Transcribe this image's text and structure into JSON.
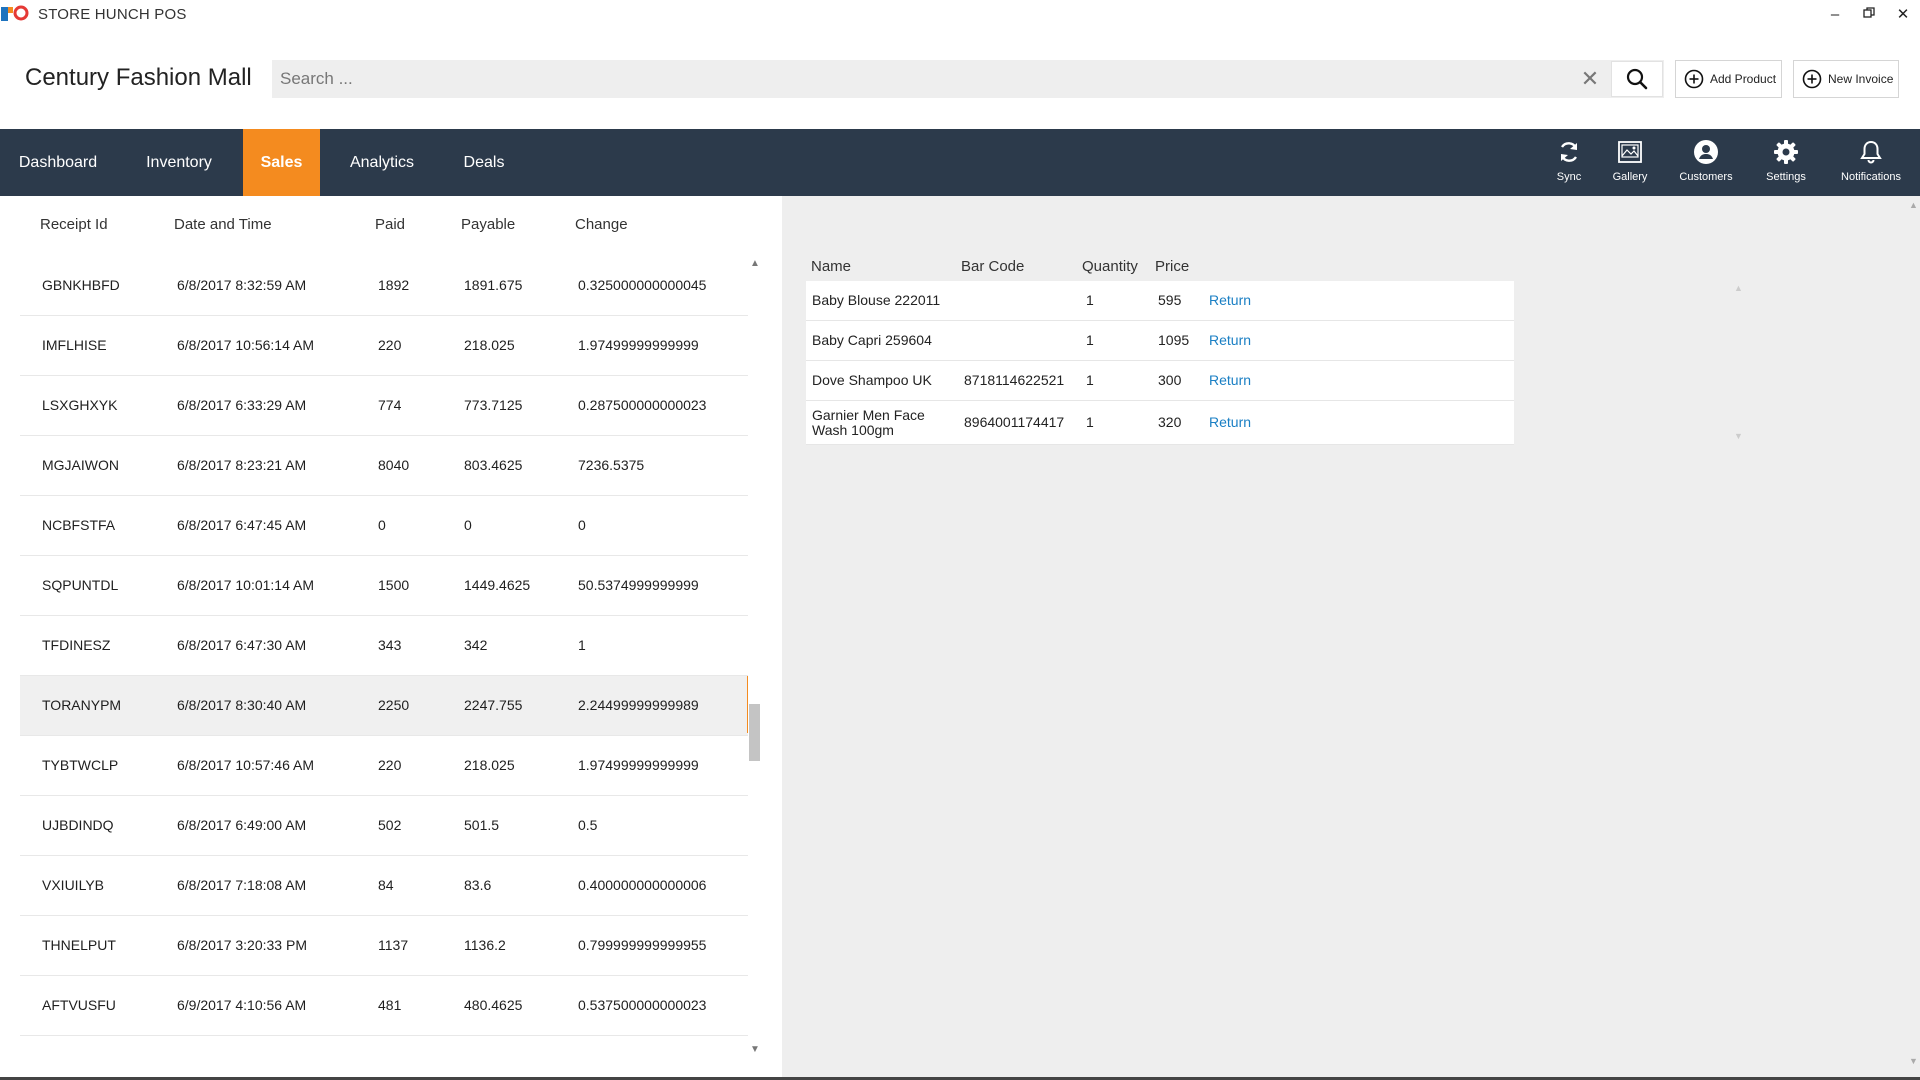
{
  "app": {
    "title": "STORE HUNCH POS"
  },
  "window": {
    "minimize": "–",
    "restore": "▫",
    "close": "✕"
  },
  "header": {
    "store_name": "Century Fashion Mall",
    "search_placeholder": "Search ...",
    "clear_glyph": "✕",
    "add_product_label": "Add Product",
    "new_invoice_label": "New Invoice"
  },
  "nav": {
    "tabs": [
      {
        "label": "Dashboard"
      },
      {
        "label": "Inventory"
      },
      {
        "label": "Sales",
        "active": true
      },
      {
        "label": "Analytics"
      },
      {
        "label": "Deals"
      }
    ],
    "icons": [
      {
        "label": "Sync",
        "icon": "sync-icon"
      },
      {
        "label": "Gallery",
        "icon": "gallery-icon"
      },
      {
        "label": "Customers",
        "icon": "user-icon"
      },
      {
        "label": "Settings",
        "icon": "gear-icon"
      },
      {
        "label": "Notifications",
        "icon": "bell-icon"
      }
    ]
  },
  "receipts": {
    "columns": [
      "Receipt Id",
      "Date and Time",
      "Paid",
      "Payable",
      "Change"
    ],
    "rows": [
      {
        "id": "GBNKHBFD",
        "datetime": "6/8/2017 8:32:59 AM",
        "paid": "1892",
        "payable": "1891.675",
        "change": "0.325000000000045"
      },
      {
        "id": "IMFLHISE",
        "datetime": "6/8/2017 10:56:14 AM",
        "paid": "220",
        "payable": "218.025",
        "change": "1.97499999999999"
      },
      {
        "id": "LSXGHXYK",
        "datetime": "6/8/2017 6:33:29 AM",
        "paid": "774",
        "payable": "773.7125",
        "change": "0.287500000000023"
      },
      {
        "id": "MGJAIWON",
        "datetime": "6/8/2017 8:23:21 AM",
        "paid": "8040",
        "payable": "803.4625",
        "change": "7236.5375"
      },
      {
        "id": "NCBFSTFA",
        "datetime": "6/8/2017 6:47:45 AM",
        "paid": "0",
        "payable": "0",
        "change": "0"
      },
      {
        "id": "SQPUNTDL",
        "datetime": "6/8/2017 10:01:14 AM",
        "paid": "1500",
        "payable": "1449.4625",
        "change": "50.5374999999999"
      },
      {
        "id": "TFDINESZ",
        "datetime": "6/8/2017 6:47:30 AM",
        "paid": "343",
        "payable": "342",
        "change": "1"
      },
      {
        "id": "TORANYPM",
        "datetime": "6/8/2017 8:30:40 AM",
        "paid": "2250",
        "payable": "2247.755",
        "change": "2.24499999999989",
        "selected": true
      },
      {
        "id": "TYBTWCLP",
        "datetime": "6/8/2017 10:57:46 AM",
        "paid": "220",
        "payable": "218.025",
        "change": "1.97499999999999"
      },
      {
        "id": "UJBDINDQ",
        "datetime": "6/8/2017 6:49:00 AM",
        "paid": "502",
        "payable": "501.5",
        "change": "0.5"
      },
      {
        "id": "VXIUILYB",
        "datetime": "6/8/2017 7:18:08 AM",
        "paid": "84",
        "payable": "83.6",
        "change": "0.400000000000006"
      },
      {
        "id": "THNELPUT",
        "datetime": "6/8/2017 3:20:33 PM",
        "paid": "1137",
        "payable": "1136.2",
        "change": "0.799999999999955"
      },
      {
        "id": "AFTVUSFU",
        "datetime": "6/9/2017 4:10:56 AM",
        "paid": "481",
        "payable": "480.4625",
        "change": "0.537500000000023"
      }
    ]
  },
  "details": {
    "columns": [
      "Name",
      "Bar Code",
      "Quantity",
      "Price"
    ],
    "rows": [
      {
        "name": "Baby Blouse 222011",
        "barcode": "",
        "qty": "1",
        "price": "595",
        "action": "Return"
      },
      {
        "name": "Baby Capri 259604",
        "barcode": "",
        "qty": "1",
        "price": "1095",
        "action": "Return"
      },
      {
        "name": "Dove Shampoo UK",
        "barcode": "8718114622521",
        "qty": "1",
        "price": "300",
        "action": "Return"
      },
      {
        "name": "Garnier Men Face Wash 100gm",
        "barcode": "8964001174417",
        "qty": "1",
        "price": "320",
        "action": "Return"
      }
    ]
  },
  "colors": {
    "nav_bg": "#2c3a4b",
    "accent": "#f48b1f",
    "link": "#1a7fc4",
    "panel_bg": "#eeeeee"
  }
}
